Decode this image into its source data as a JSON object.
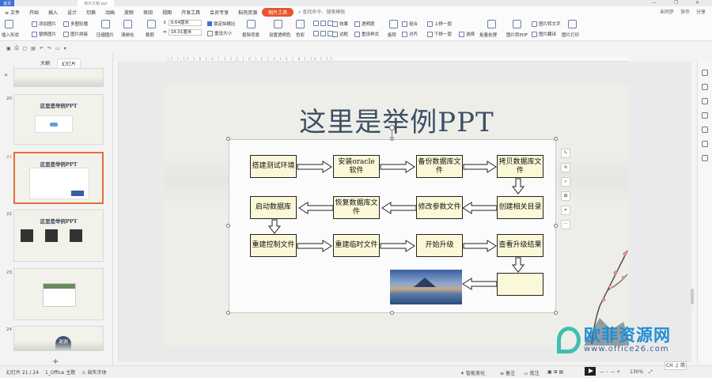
{
  "titlebar": {
    "home": "首页",
    "doc_title": "演示文稿.ppt"
  },
  "menu": {
    "file": "文件",
    "items": [
      "开始",
      "插入",
      "设计",
      "切换",
      "动画",
      "放映",
      "审阅",
      "视图",
      "开发工具",
      "会员专享",
      "稻壳资源"
    ],
    "active_tab": "图片工具",
    "search": "查找命令、搜索模板",
    "right": [
      "未同步",
      "协作",
      "分享"
    ]
  },
  "ribbon": {
    "insert_shape": "插入形状",
    "add_picture": "添加图片",
    "multi_crop": "多图轮播",
    "replace_picture": "替换图片",
    "picture_split": "图片拼接",
    "compress": "压缩图片",
    "sharpen": "清晰化",
    "crop": "裁剪",
    "height": "9.64厘米",
    "width": "18.01厘米",
    "lock_ratio": "锁定纵横比",
    "reset_size": "重设大小",
    "remove_bg": "抠除背景",
    "set_transparent": "设置透明色",
    "color": "色彩",
    "effects": "效果",
    "border": "边框",
    "transparency": "透明度",
    "reset_style": "重设样式",
    "combine": "组合",
    "rotate": "旋转",
    "align": "对齐",
    "bring_forward": "上移一层",
    "send_backward": "下移一层",
    "select": "选择",
    "batch": "批量处理",
    "to_pdf": "图片转PDF",
    "to_text": "图片转文字",
    "translate": "图片翻译",
    "print": "图片打印"
  },
  "panel": {
    "tab_outline": "大纲",
    "tab_slides": "幻灯片",
    "slides": [
      {
        "num": "20",
        "title": "这里是举例PPT"
      },
      {
        "num": "21",
        "title": "这里是举例PPT"
      },
      {
        "num": "22",
        "title": "这里是举例PPT"
      },
      {
        "num": "23",
        "title": ""
      },
      {
        "num": "24",
        "title": "谢谢"
      }
    ]
  },
  "ruler_text": "·12·1·10·1·8·1·6·1·4·1·2·1·0·1·2·1·4·1·6·1·8·1·10·1·12·",
  "slide": {
    "title": "这里是举例PPT",
    "flow": [
      "搭建测试环境",
      "安装oracle软件",
      "备份数据库文件",
      "拷贝数据库文件",
      "启动数据库",
      "恢复数据库文件",
      "修改参数文件",
      "创建相关目录",
      "重建控制文件",
      "重建临时文件",
      "开始升级",
      "查看升级结果"
    ]
  },
  "floatbar": [
    "✎",
    "≋",
    "⌕",
    "✿",
    "⌗",
    "···"
  ],
  "watermark": {
    "cn": "欧菲资源网",
    "url": "www.office26.com"
  },
  "status": {
    "slide_pos": "幻灯片 21 / 24",
    "theme": "1_Office 主题",
    "missing_font": "缺失字体",
    "smart": "智能美化",
    "notes": "备注",
    "comments": "批注",
    "zoom": "130%",
    "ime": "CH ♫ 简"
  }
}
